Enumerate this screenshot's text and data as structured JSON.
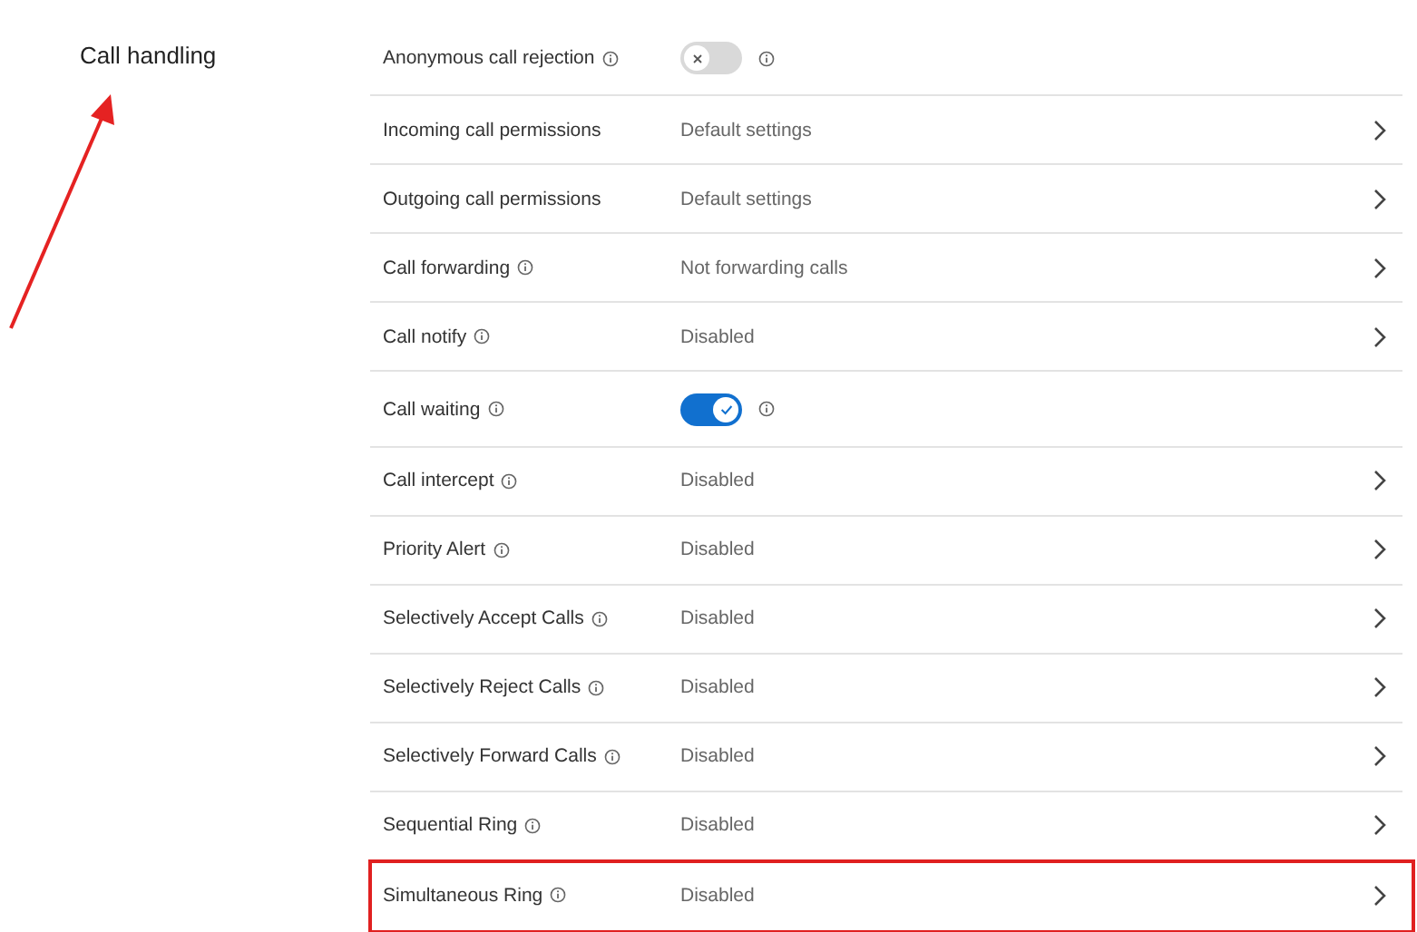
{
  "section": {
    "title": "Call handling"
  },
  "settings": [
    {
      "kind": "toggle",
      "label": "Anonymous call rejection",
      "info": true,
      "on": false,
      "highlighted": false
    },
    {
      "kind": "link",
      "label": "Incoming call permissions",
      "info": false,
      "value": "Default settings",
      "highlighted": false
    },
    {
      "kind": "link",
      "label": "Outgoing call permissions",
      "info": false,
      "value": "Default settings",
      "highlighted": false
    },
    {
      "kind": "link",
      "label": "Call forwarding",
      "info": true,
      "value": "Not forwarding calls",
      "highlighted": false
    },
    {
      "kind": "link",
      "label": "Call notify",
      "info": true,
      "value": "Disabled",
      "highlighted": false
    },
    {
      "kind": "toggle",
      "label": "Call waiting",
      "info": true,
      "on": true,
      "highlighted": false
    },
    {
      "kind": "link",
      "label": "Call intercept",
      "info": true,
      "value": "Disabled",
      "highlighted": false
    },
    {
      "kind": "link",
      "label": "Priority Alert",
      "info": true,
      "value": "Disabled",
      "highlighted": false
    },
    {
      "kind": "link",
      "label": "Selectively Accept Calls",
      "info": true,
      "value": "Disabled",
      "highlighted": false
    },
    {
      "kind": "link",
      "label": "Selectively Reject Calls",
      "info": true,
      "value": "Disabled",
      "highlighted": false
    },
    {
      "kind": "link",
      "label": "Selectively Forward Calls",
      "info": true,
      "value": "Disabled",
      "highlighted": false
    },
    {
      "kind": "link",
      "label": "Sequential Ring",
      "info": true,
      "value": "Disabled",
      "highlighted": false
    },
    {
      "kind": "link",
      "label": "Simultaneous Ring",
      "info": true,
      "value": "Disabled",
      "highlighted": true
    }
  ]
}
